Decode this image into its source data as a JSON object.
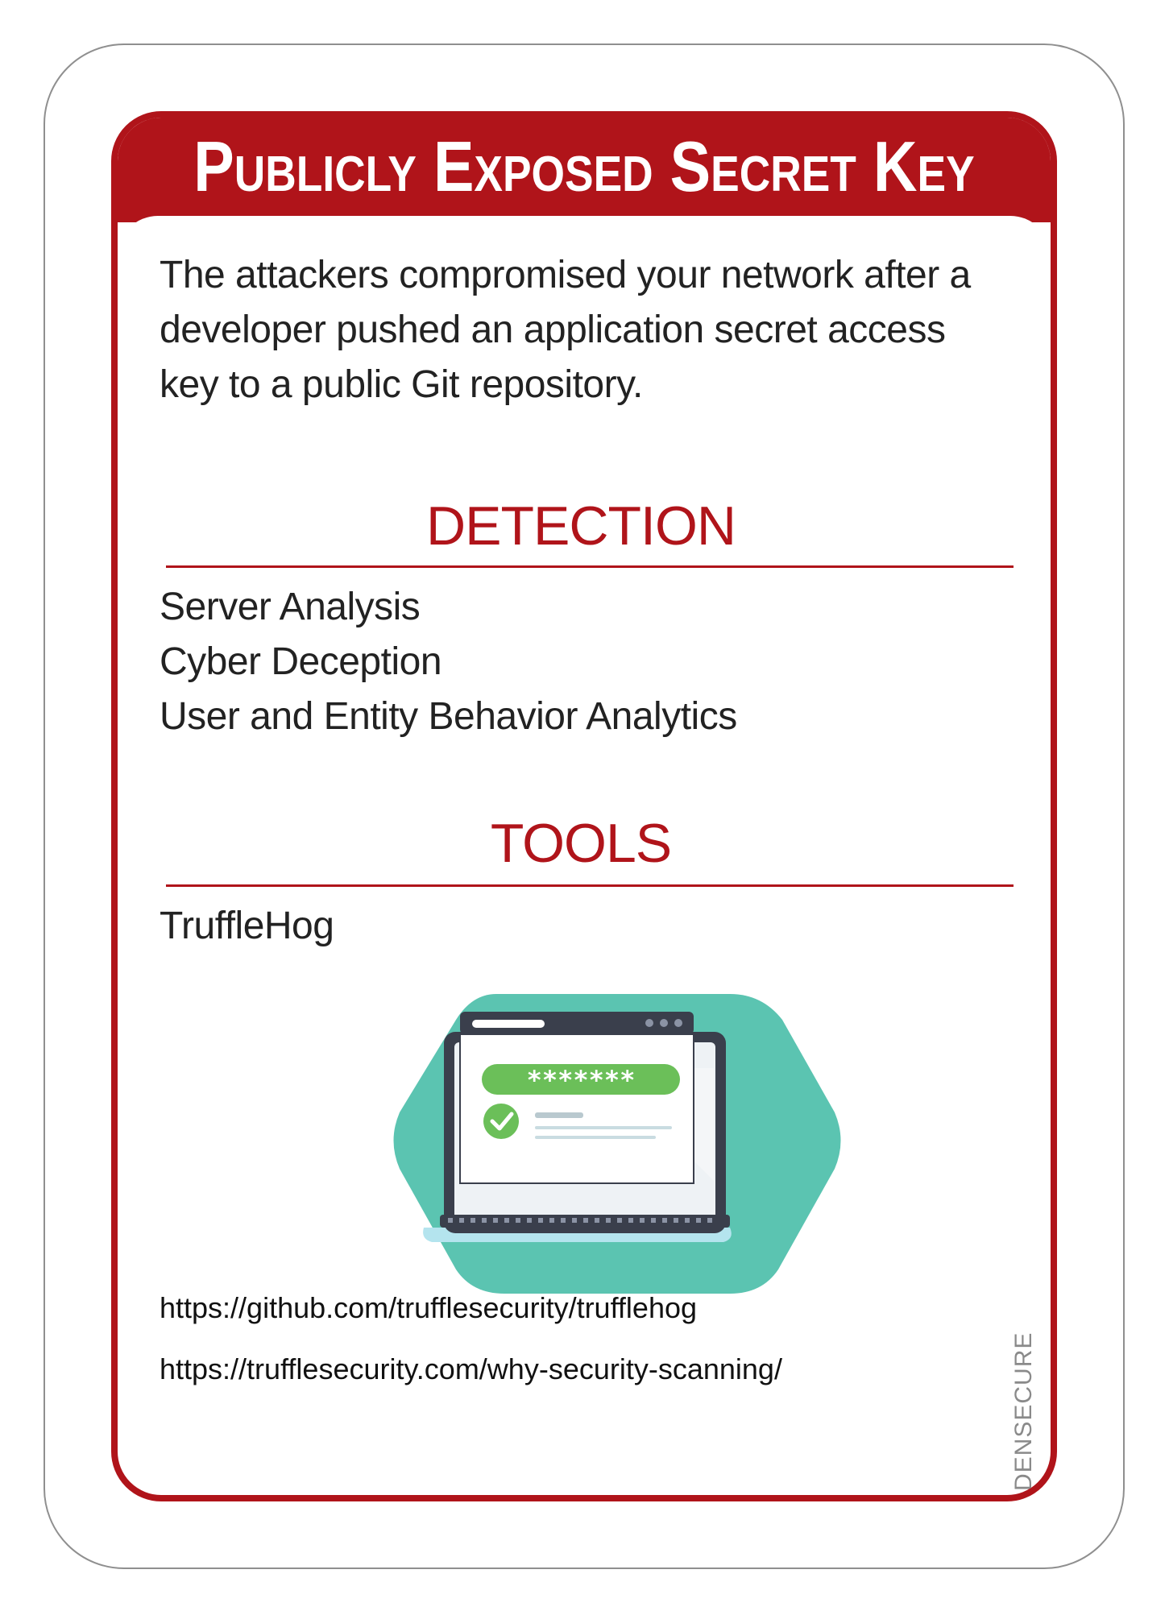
{
  "card": {
    "title": "Publicly Exposed Secret Key",
    "description": "The attackers compromised your network after a developer pushed an application secret access key to a public Git repository.",
    "detection": {
      "heading": "DETECTION",
      "items": [
        "Server Analysis",
        "Cyber Deception",
        "User and Entity Behavior Analytics"
      ]
    },
    "tools": {
      "heading": "TOOLS",
      "items": [
        "TruffleHog"
      ]
    },
    "illustration": {
      "password_mask": "*******",
      "icons": [
        "laptop-icon",
        "password-field-icon",
        "check-circle-icon"
      ]
    },
    "links": [
      "https://github.com/trufflesecurity/trufflehog",
      "https://trufflesecurity.com/why-security-scanning/"
    ],
    "brand": "DENSECURE"
  },
  "colors": {
    "accent_red": "#b0141a",
    "teal": "#5bc4b1",
    "green": "#6bbf59",
    "laptop_dark": "#3a3f4c"
  }
}
